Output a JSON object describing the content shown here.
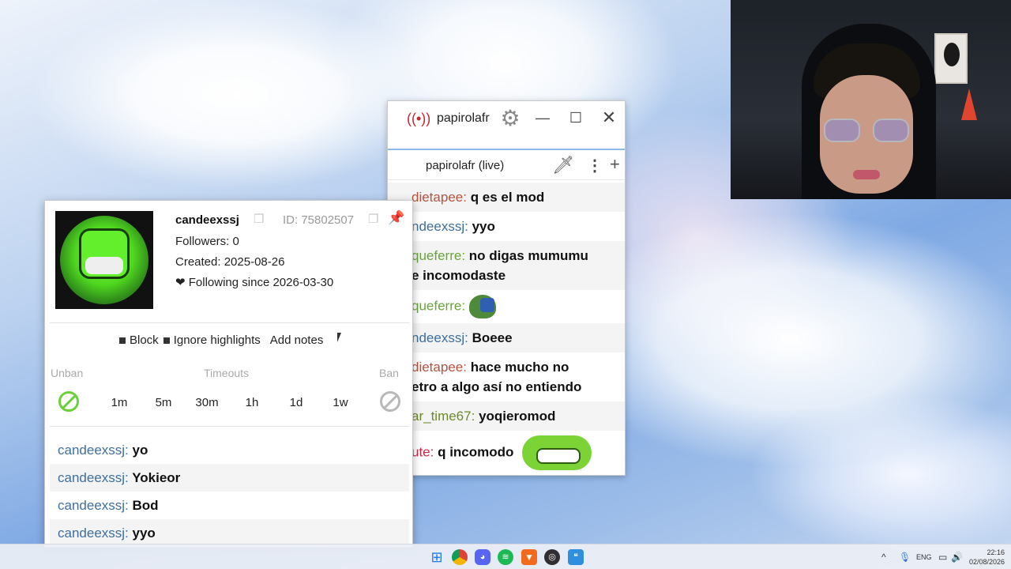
{
  "chat_window": {
    "title": "papirolafr",
    "split_title": "papirolafr (live)",
    "messages": [
      {
        "user": "dietapee:",
        "text": "q es el mod",
        "user_color": "#b5523f"
      },
      {
        "user": "ndeexssj:",
        "text": "yyo",
        "user_color": "#3e6f9e"
      },
      {
        "user": "queferre:",
        "text": "no digas mumumu",
        "user_color": "#6aa43b"
      },
      {
        "user": "",
        "text": "e incomodaste",
        "user_color": "#111111"
      },
      {
        "user": "queferre:",
        "text": "",
        "user_color": "#6aa43b",
        "emote": "pepe-emote"
      },
      {
        "user": "ndeexssj:",
        "text": "Boeee",
        "user_color": "#3e6f9e"
      },
      {
        "user": "dietapee:",
        "text": "hace mucho no",
        "user_color": "#b5523f"
      },
      {
        "user": "",
        "text": "etro a algo así no entiendo",
        "user_color": "#111111"
      },
      {
        "user": "ar_time67:",
        "text": "yoqieromod",
        "user_color": "#6d8a2a"
      },
      {
        "user": "ute:",
        "text": "q incomodo",
        "user_color": "#c42a4a",
        "emote": "grin-emote"
      }
    ]
  },
  "user_popup": {
    "username": "candeexssj",
    "id": "ID: 75802507",
    "followers": "Followers: 0",
    "created": "Created: 2025-08-26",
    "following": "❤ Following since 2026-03-30",
    "actions": {
      "block": "Block",
      "ignore": "Ignore highlights",
      "notes": "Add notes"
    },
    "mod": {
      "unban": "Unban",
      "timeouts": "Timeouts",
      "ban": "Ban",
      "durations": [
        "1m",
        "5m",
        "30m",
        "1h",
        "1d",
        "1w"
      ]
    },
    "recent_messages": [
      {
        "user": "candeexssj:",
        "text": "yo"
      },
      {
        "user": "candeexssj:",
        "text": "Yokieor"
      },
      {
        "user": "candeexssj:",
        "text": "Bod"
      },
      {
        "user": "candeexssj:",
        "text": "yyo"
      }
    ],
    "user_color": "#3e6f9e"
  },
  "taskbar": {
    "lang": "ENG",
    "time": "22:16",
    "date": "02/08/2026"
  },
  "colors": {
    "accent": "#8fb8e6",
    "live_red": "#c1272d",
    "unban_green": "#6bd13a"
  }
}
